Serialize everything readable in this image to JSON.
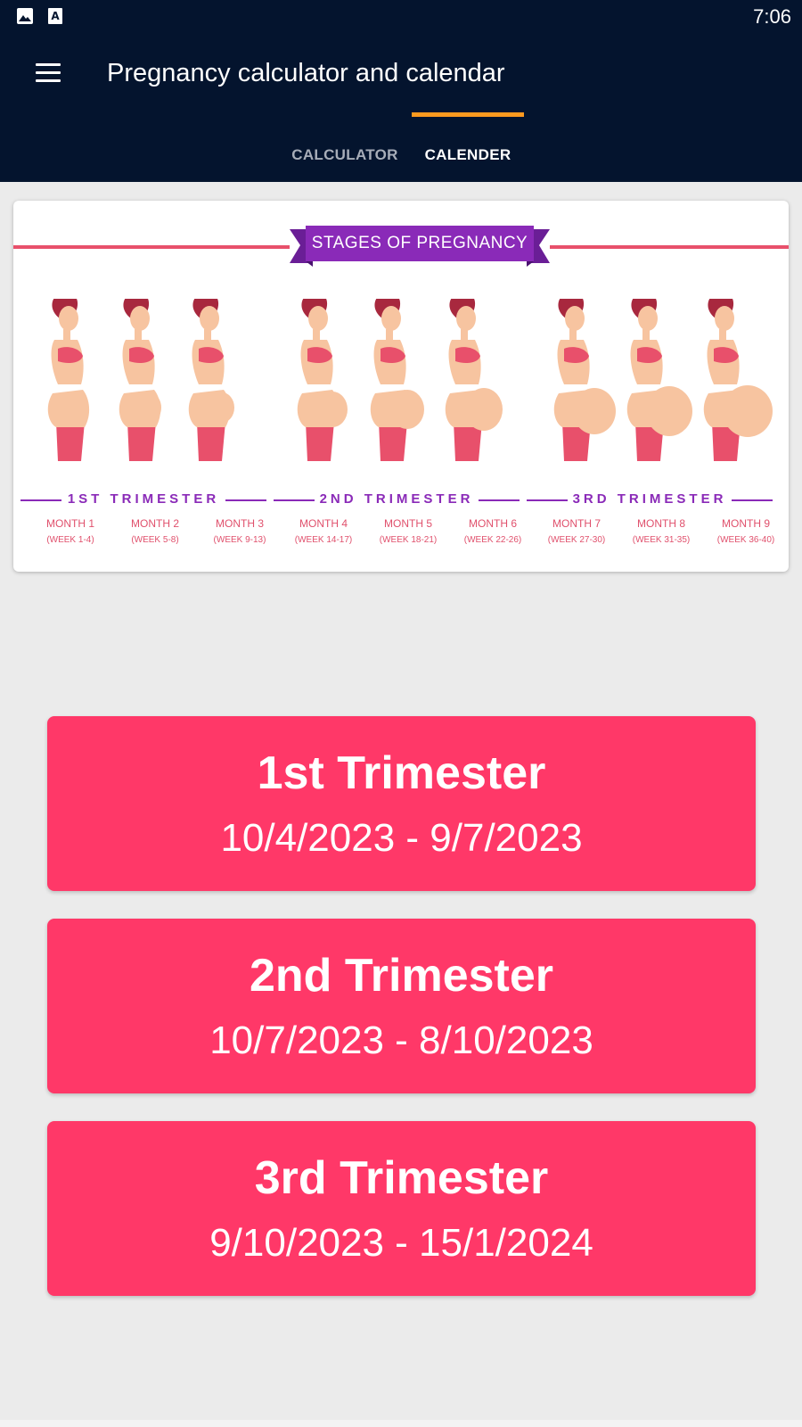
{
  "status_bar": {
    "time": "7:06",
    "icons": [
      "image-icon",
      "font-icon"
    ]
  },
  "app_bar": {
    "title": "Pregnancy calculator and calendar",
    "menu_icon": "menu-icon",
    "tabs": [
      {
        "label": "CALCULATOR",
        "selected": false
      },
      {
        "label": "CALENDER",
        "selected": true
      }
    ]
  },
  "stages_image": {
    "banner": "STAGES OF PREGNANCY",
    "trimesters": [
      "1ST TRIMESTER",
      "2ND TRIMESTER",
      "3RD TRIMESTER"
    ],
    "months": [
      {
        "name": "MONTH 1",
        "weeks": "(WEEK 1-4)"
      },
      {
        "name": "MONTH 2",
        "weeks": "(WEEK 5-8)"
      },
      {
        "name": "MONTH 3",
        "weeks": "(WEEK 9-13)"
      },
      {
        "name": "MONTH 4",
        "weeks": "(WEEK 14-17)"
      },
      {
        "name": "MONTH 5",
        "weeks": "(WEEK 18-21)"
      },
      {
        "name": "MONTH 6",
        "weeks": "(WEEK 22-26)"
      },
      {
        "name": "MONTH 7",
        "weeks": "(WEEK 27-30)"
      },
      {
        "name": "MONTH 8",
        "weeks": "(WEEK 31-35)"
      },
      {
        "name": "MONTH 9",
        "weeks": "(WEEK 36-40)"
      }
    ]
  },
  "trimester_cards": [
    {
      "title": "1st Trimester",
      "dates": "10/4/2023 - 9/7/2023"
    },
    {
      "title": "2nd Trimester",
      "dates": "10/7/2023 - 8/10/2023"
    },
    {
      "title": "3rd Trimester",
      "dates": "9/10/2023 - 15/1/2024"
    }
  ],
  "colors": {
    "app_bar": "#04142e",
    "tab_indicator": "#ff9a1f",
    "card": "#ff3868",
    "banner": "#8a2ab8",
    "background": "#ebebeb"
  }
}
